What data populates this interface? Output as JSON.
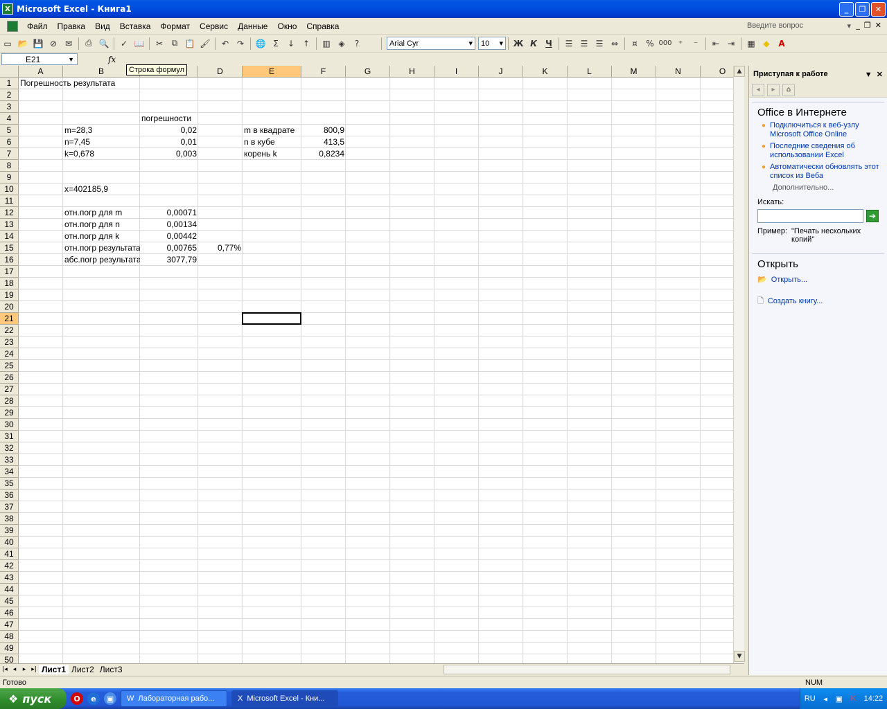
{
  "window": {
    "title": "Microsoft Excel - Книга1"
  },
  "menu": [
    "Файл",
    "Правка",
    "Вид",
    "Вставка",
    "Формат",
    "Сервис",
    "Данные",
    "Окно",
    "Справка"
  ],
  "ask_question": "Введите вопрос",
  "toolbar": {
    "font_name": "Arial Cyr",
    "font_size": "10",
    "bold": "Ж",
    "italic": "К",
    "underline": "Ч",
    "percent": "%",
    "thousands": "000"
  },
  "formula_bar": {
    "name_box": "E21",
    "fx": "fx",
    "tooltip": "Строка формул"
  },
  "columns": [
    "A",
    "B",
    "C",
    "D",
    "E",
    "F",
    "G",
    "H",
    "I",
    "J",
    "K",
    "L",
    "M",
    "N",
    "O"
  ],
  "rows": [
    "1",
    "2",
    "3",
    "4",
    "5",
    "6",
    "7",
    "8",
    "9",
    "10",
    "11",
    "12",
    "13",
    "14",
    "15",
    "16",
    "17",
    "18",
    "19",
    "20",
    "21",
    "22",
    "23",
    "24",
    "25",
    "26",
    "27",
    "28",
    "29",
    "30",
    "31",
    "32",
    "33",
    "34",
    "35",
    "36",
    "37",
    "38",
    "39",
    "40",
    "41",
    "42",
    "43",
    "44",
    "45",
    "46",
    "47",
    "48",
    "49",
    "50"
  ],
  "cells": {
    "A1": "Погрешность результата",
    "C4": "погрешности",
    "B5": "m=28,3",
    "C5": "0,02",
    "E5": "m в квадрате",
    "F5": "800,9",
    "B6": "n=7,45",
    "C6": "0,01",
    "E6": "n в кубе",
    "F6": "413,5",
    "B7": "k=0,678",
    "C7": "0,003",
    "E7": "корень k",
    "F7": "0,8234",
    "B10": "x=402185,9",
    "B12": "отн.погр для m",
    "C12": "0,00071",
    "B13": "отн.погр для n",
    "C13": "0,00134",
    "B14": "отн.погр для k",
    "C14": "0,00442",
    "B15": "отн.погр результата",
    "C15": "0,00765",
    "D15": "0,77%",
    "B16": "абс.погр результата",
    "C16": "3077,79"
  },
  "sheets": [
    "Лист1",
    "Лист2",
    "Лист3"
  ],
  "status": {
    "ready": "Готово",
    "num": "NUM"
  },
  "taskpane": {
    "title": "Приступая к работе",
    "office_online": "Office в Интернете",
    "links": [
      "Подключиться к веб-узлу Microsoft Office Online",
      "Последние сведения об использовании Excel",
      "Автоматически обновлять этот список из Веба"
    ],
    "more": "Дополнительно...",
    "search_label": "Искать:",
    "example_label": "Пример:",
    "example_text": "\"Печать нескольких копий\"",
    "open_section": "Открыть",
    "open_link": "Открыть...",
    "new_link": "Создать книгу..."
  },
  "taskbar": {
    "start": "пуск",
    "items": [
      "Лабораторная рабо...",
      "Microsoft Excel - Кни..."
    ],
    "lang": "RU",
    "clock": "14:22"
  }
}
